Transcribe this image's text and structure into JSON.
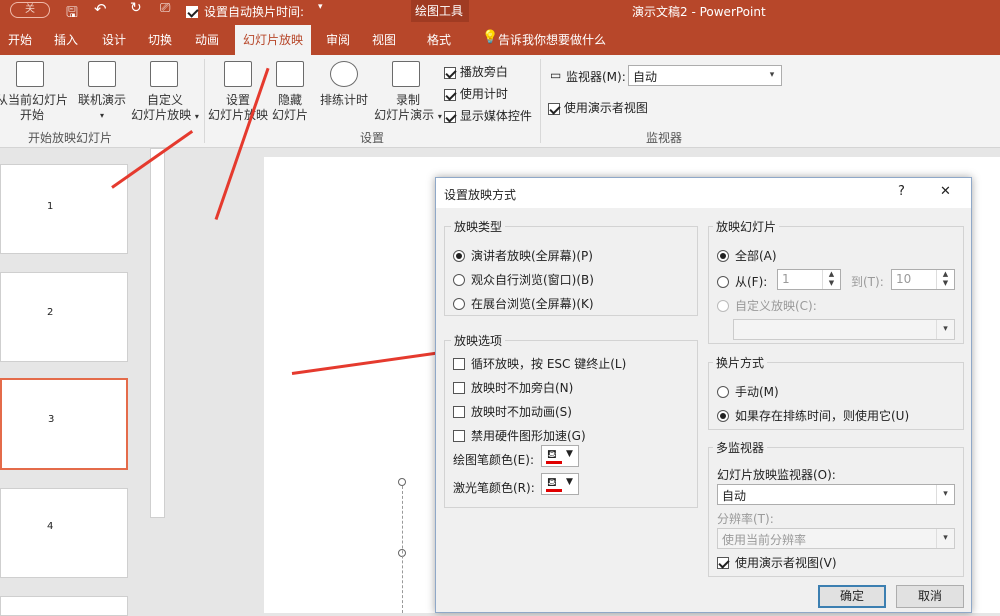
{
  "titlebar": {
    "toggle_label": "关",
    "checkbox_label": "设置自动换片时间:",
    "doc_title": "演示文稿2 - PowerPoint",
    "contextual_group": "绘图工具"
  },
  "tabs": [
    "开始",
    "插入",
    "设计",
    "切换",
    "动画",
    "幻灯片放映",
    "审阅",
    "视图",
    "格式"
  ],
  "active_tab": "幻灯片放映",
  "tell_me": "告诉我你想要做什么",
  "ribbon": {
    "from_current": [
      "从当前幻灯片",
      "开始"
    ],
    "online": "联机演示",
    "custom": [
      "自定义",
      "幻灯片放映"
    ],
    "setup": [
      "设置",
      "幻灯片放映"
    ],
    "hide": [
      "隐藏",
      "幻灯片"
    ],
    "rehearse": "排练计时",
    "record": [
      "录制",
      "幻灯片演示"
    ],
    "chk_narration": "播放旁白",
    "chk_timings": "使用计时",
    "chk_media": "显示媒体控件",
    "monitor_label": "监视器(M):",
    "monitor_value": "自动",
    "presenter_view": "使用演示者视图",
    "group_start": "开始放映幻灯片",
    "group_setup": "设置",
    "group_monitors": "监视器"
  },
  "slides": [
    "1",
    "2",
    "3",
    "4"
  ],
  "dialog": {
    "title": "设置放映方式",
    "help": "?",
    "close": "✕",
    "show_type": {
      "legend": "放映类型",
      "options": [
        "演讲者放映(全屏幕)(P)",
        "观众自行浏览(窗口)(B)",
        "在展台浏览(全屏幕)(K)"
      ],
      "selected": 0
    },
    "show_options": {
      "legend": "放映选项",
      "checks": [
        "循环放映，按 ESC 键终止(L)",
        "放映时不加旁白(N)",
        "放映时不加动画(S)",
        "禁用硬件图形加速(G)"
      ],
      "pen_color": "绘图笔颜色(E):",
      "laser_color": "激光笔颜色(R):"
    },
    "show_slides": {
      "legend": "放映幻灯片",
      "all": "全部(A)",
      "from": "从(F):",
      "from_value": "1",
      "to": "到(T):",
      "to_value": "10",
      "custom": "自定义放映(C):"
    },
    "advance": {
      "legend": "换片方式",
      "manual": "手动(M)",
      "timings": "如果存在排练时间，则使用它(U)"
    },
    "multi_monitor": {
      "legend": "多监视器",
      "monitor_label": "幻灯片放映监视器(O):",
      "monitor_value": "自动",
      "resolution_label": "分辨率(T):",
      "resolution_value": "使用当前分辨率",
      "presenter_view": "使用演示者视图(V)"
    },
    "ok": "确定",
    "cancel": "取消"
  }
}
